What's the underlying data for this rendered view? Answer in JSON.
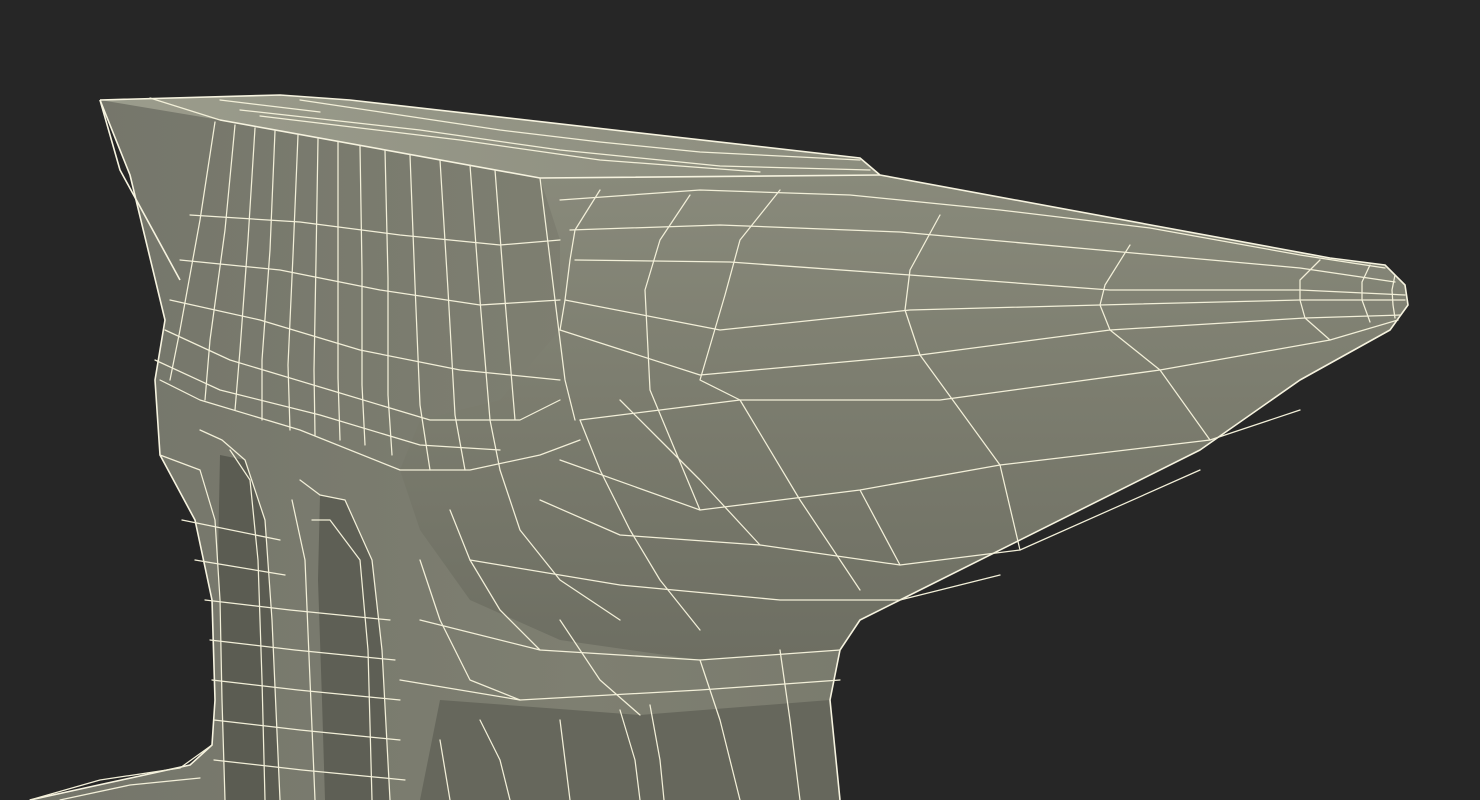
{
  "viewport": {
    "background": "#262626",
    "model_subject": "anvil-wireframe",
    "surface_color": "#7a7b6d",
    "surface_shade_color": "#5f6055",
    "top_face_color": "#8f9080",
    "wire_color": "#f2efd8"
  }
}
